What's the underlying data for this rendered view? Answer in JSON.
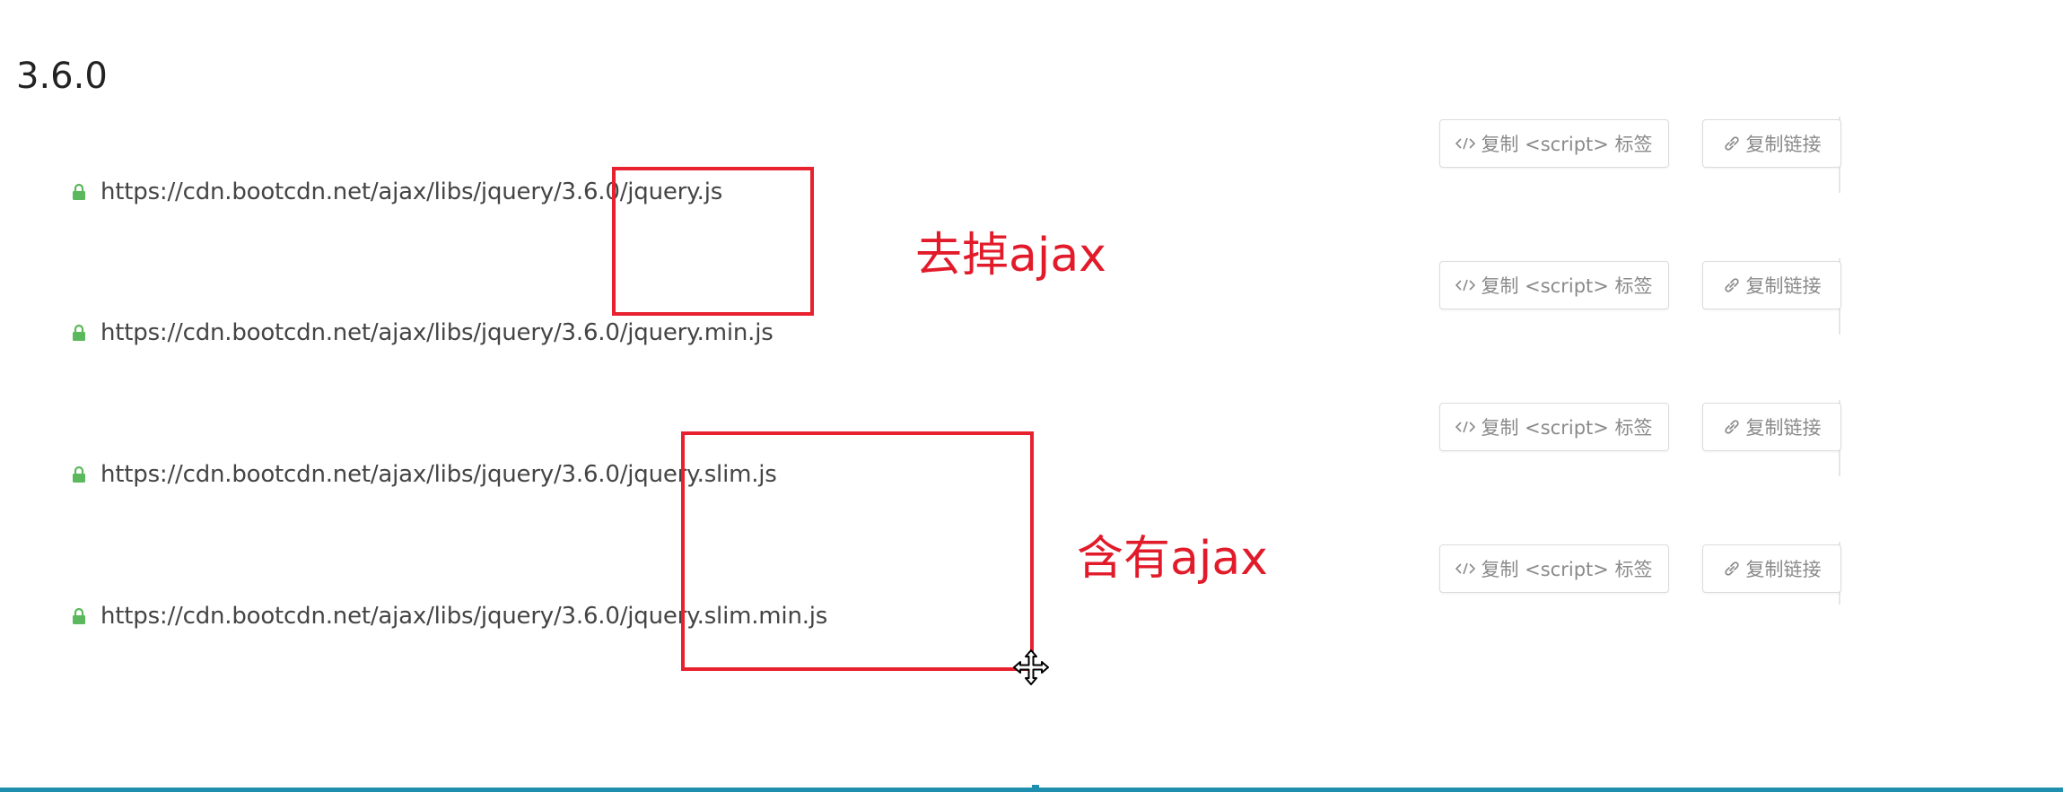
{
  "version": "3.6.0",
  "files": [
    {
      "url": "https://cdn.bootcdn.net/ajax/libs/jquery/3.6.0/jquery.js"
    },
    {
      "url": "https://cdn.bootcdn.net/ajax/libs/jquery/3.6.0/jquery.min.js"
    },
    {
      "url": "https://cdn.bootcdn.net/ajax/libs/jquery/3.6.0/jquery.slim.js"
    },
    {
      "url": "https://cdn.bootcdn.net/ajax/libs/jquery/3.6.0/jquery.slim.min.js"
    }
  ],
  "buttons": {
    "copy_script_label": "复制 <script> 标签",
    "copy_link_label": "复制链接",
    "copy_script_icon": "code-icon",
    "copy_link_icon": "link-icon"
  },
  "annotations": {
    "remove_ajax": "去掉ajax",
    "contains_ajax": "含有ajax",
    "color": "#e8212f"
  },
  "colors": {
    "lock": "#5cb85c",
    "accent_bar": "#1f8fb0"
  }
}
